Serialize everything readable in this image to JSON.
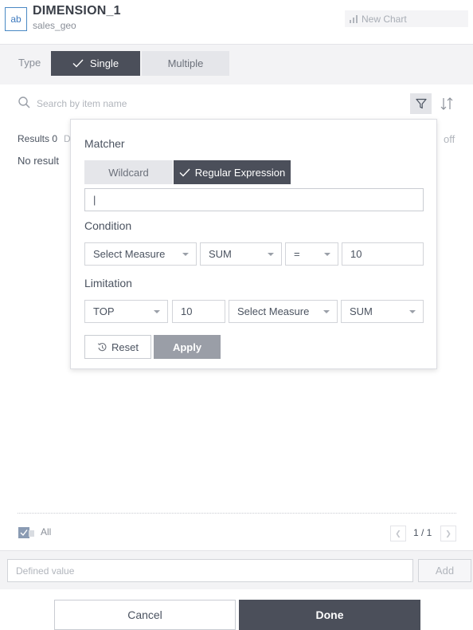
{
  "header": {
    "icon_text": "ab",
    "title": "DIMENSION_1",
    "subtitle": "sales_geo",
    "new_chart_label": "New Chart"
  },
  "type_bar": {
    "label": "Type",
    "single_label": "Single",
    "multiple_label": "Multiple",
    "selected": "Single"
  },
  "search": {
    "placeholder": "Search by item name",
    "value": ""
  },
  "results": {
    "label": "Results 0",
    "truncated_text": "D",
    "off_label": "off",
    "empty_text": "No result"
  },
  "popup": {
    "matcher_label": "Matcher",
    "wildcard_label": "Wildcard",
    "regex_label": "Regular Expression",
    "matcher_selected": "Regular Expression",
    "regex_value": "|",
    "condition_label": "Condition",
    "condition": {
      "measure": "Select Measure",
      "aggregation": "SUM",
      "operator": "=",
      "value": "10"
    },
    "limitation_label": "Limitation",
    "limitation": {
      "position": "TOP",
      "count": "10",
      "measure": "Select Measure",
      "aggregation": "SUM"
    },
    "reset_label": "Reset",
    "apply_label": "Apply"
  },
  "list_footer": {
    "all_label": "All",
    "page_label": "1 / 1"
  },
  "defined_value": {
    "placeholder": "Defined value",
    "value": "",
    "add_label": "Add"
  },
  "actions": {
    "cancel_label": "Cancel",
    "done_label": "Done"
  },
  "colors": {
    "dark_button": "#4b4f5a",
    "light_button": "#e5e6ea",
    "accent_blue": "#4a89c4",
    "apply_disabled": "#9a9ea7"
  }
}
